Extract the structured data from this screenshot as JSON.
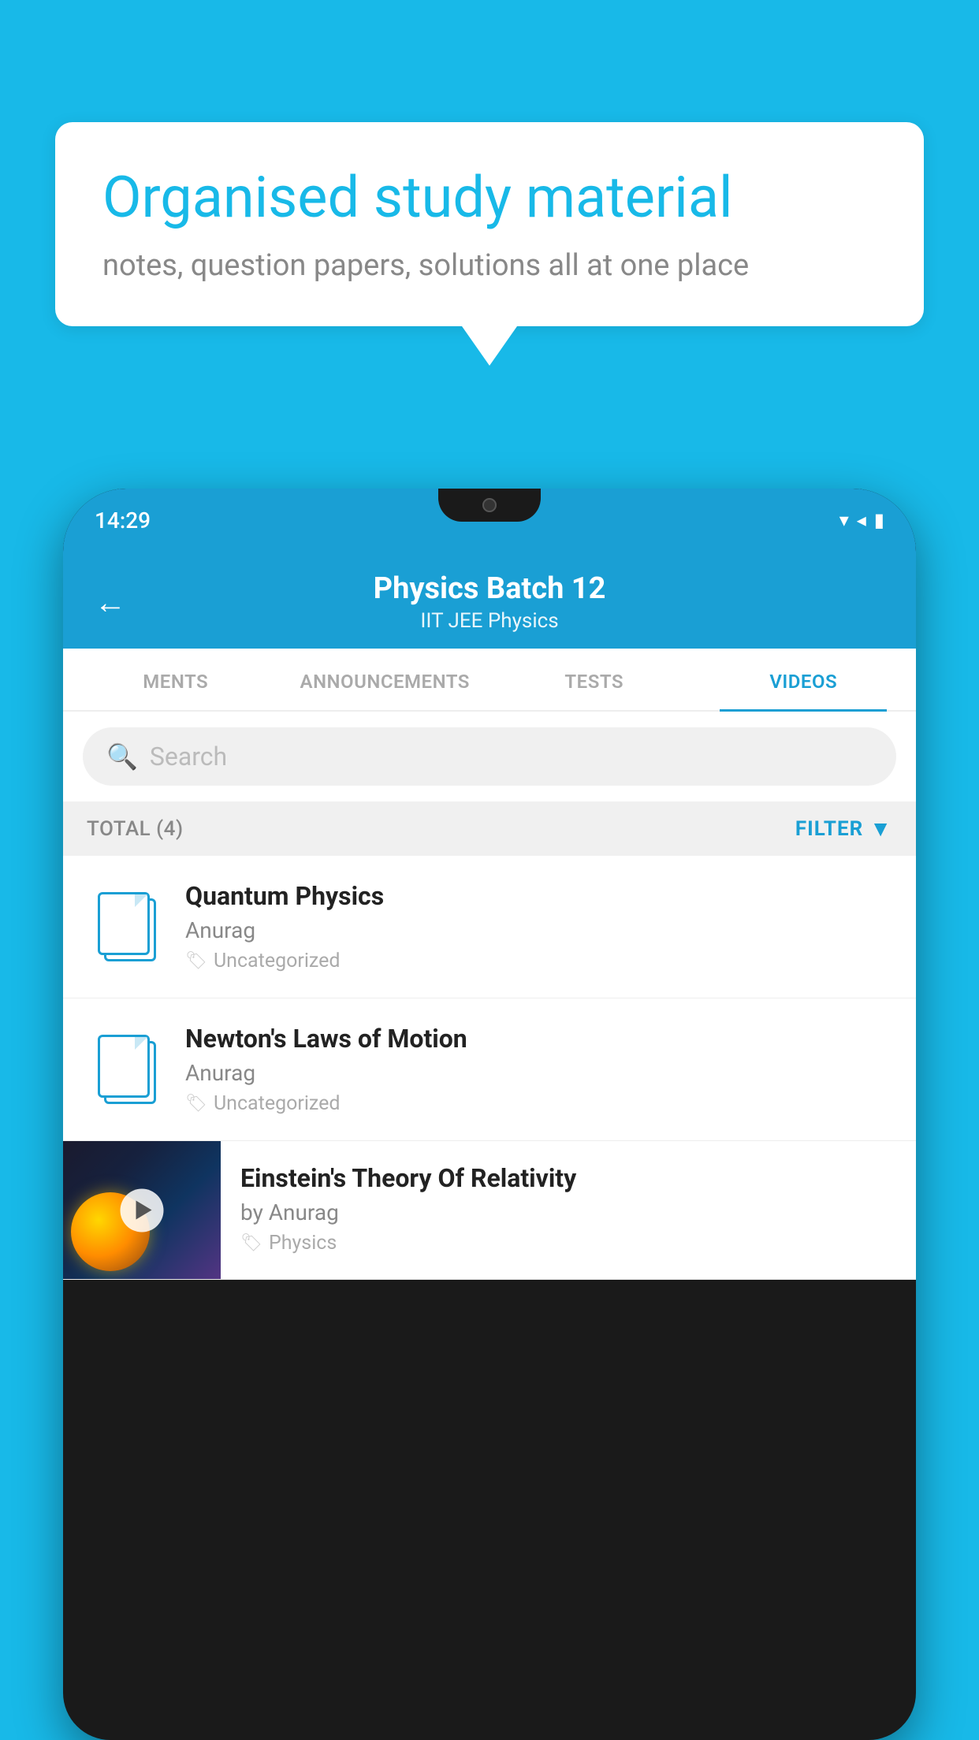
{
  "background_color": "#18b9e8",
  "speech_bubble": {
    "title": "Organised study material",
    "subtitle": "notes, question papers, solutions all at one place"
  },
  "status_bar": {
    "time": "14:29",
    "icons": [
      "wifi",
      "signal",
      "battery"
    ]
  },
  "header": {
    "back_label": "←",
    "title": "Physics Batch 12",
    "subtitle": "IIT JEE   Physics"
  },
  "tabs": [
    {
      "label": "MENTS",
      "active": false
    },
    {
      "label": "ANNOUNCEMENTS",
      "active": false
    },
    {
      "label": "TESTS",
      "active": false
    },
    {
      "label": "VIDEOS",
      "active": true
    }
  ],
  "search": {
    "placeholder": "Search"
  },
  "filter_bar": {
    "total_label": "TOTAL (4)",
    "filter_label": "FILTER"
  },
  "videos": [
    {
      "title": "Quantum Physics",
      "author": "Anurag",
      "tag": "Uncategorized",
      "has_thumbnail": false
    },
    {
      "title": "Newton's Laws of Motion",
      "author": "Anurag",
      "tag": "Uncategorized",
      "has_thumbnail": false
    },
    {
      "title": "Einstein's Theory Of Relativity",
      "author": "by Anurag",
      "tag": "Physics",
      "has_thumbnail": true
    }
  ]
}
